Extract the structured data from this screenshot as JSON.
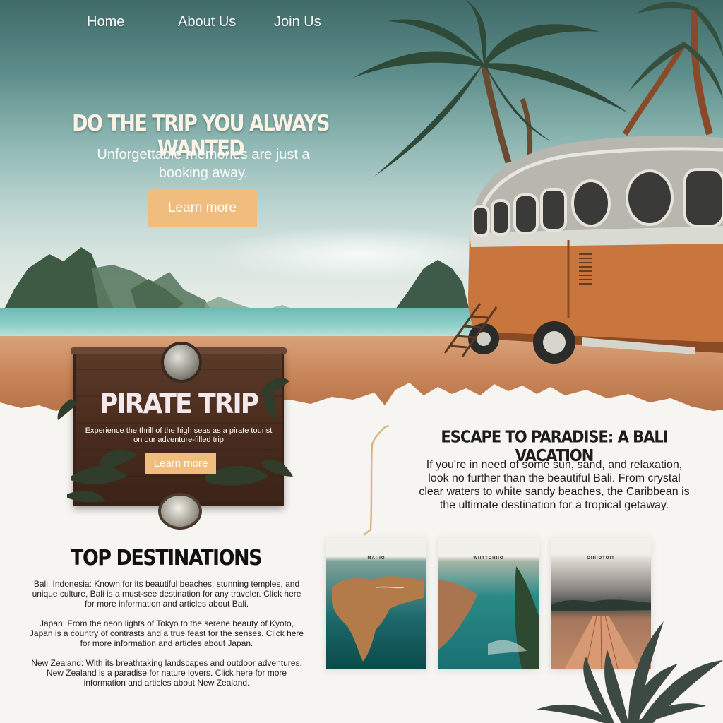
{
  "nav": {
    "items": [
      {
        "label": "Home"
      },
      {
        "label": "About Us"
      },
      {
        "label": "Join Us"
      }
    ]
  },
  "hero": {
    "title": "DO THE TRIP YOU ALWAYS WANTED",
    "subtitle": "Unforgettable memories are just a booking away.",
    "button_label": "Learn more"
  },
  "pirate": {
    "title": "PIRATE TRIP",
    "text": "Experience the thrill of the high seas as a pirate tourist on our adventure-filled trip",
    "button_label": "Learn more"
  },
  "escape": {
    "title": "ESCAPE TO PARADISE: A BALI VACATION",
    "text": "If you're in need of some sun, sand, and relaxation, look no further than the beautiful Bali. From crystal clear waters to white sandy beaches, the Caribbean is the ultimate destination for a tropical getaway."
  },
  "destinations": {
    "title": "TOP DESTINATIONS",
    "items": [
      {
        "text": "Bali, Indonesia: Known for its beautiful beaches, stunning temples, and unique culture, Bali is a must-see destination for any traveler. Click here for more information and articles about Bali."
      },
      {
        "text": "Japan: From the neon lights of Tokyo to the serene beauty of Kyoto, Japan is a country of contrasts and a true feast for the senses. Click here for more information and articles about Japan."
      },
      {
        "text": "New Zealand: With its breathtaking landscapes and outdoor adventures, New Zealand is a paradise for nature lovers. Click here for more information and articles about New Zealand."
      }
    ]
  },
  "cards": [
    {
      "label": "MAIIIO"
    },
    {
      "label": "WIITTOIIIIO"
    },
    {
      "label": "OIIIIOTOIT"
    }
  ],
  "colors": {
    "accent_button": "#f1bd7f",
    "heading_dark": "#1d1d1d",
    "page_background": "#f7f5f1"
  }
}
